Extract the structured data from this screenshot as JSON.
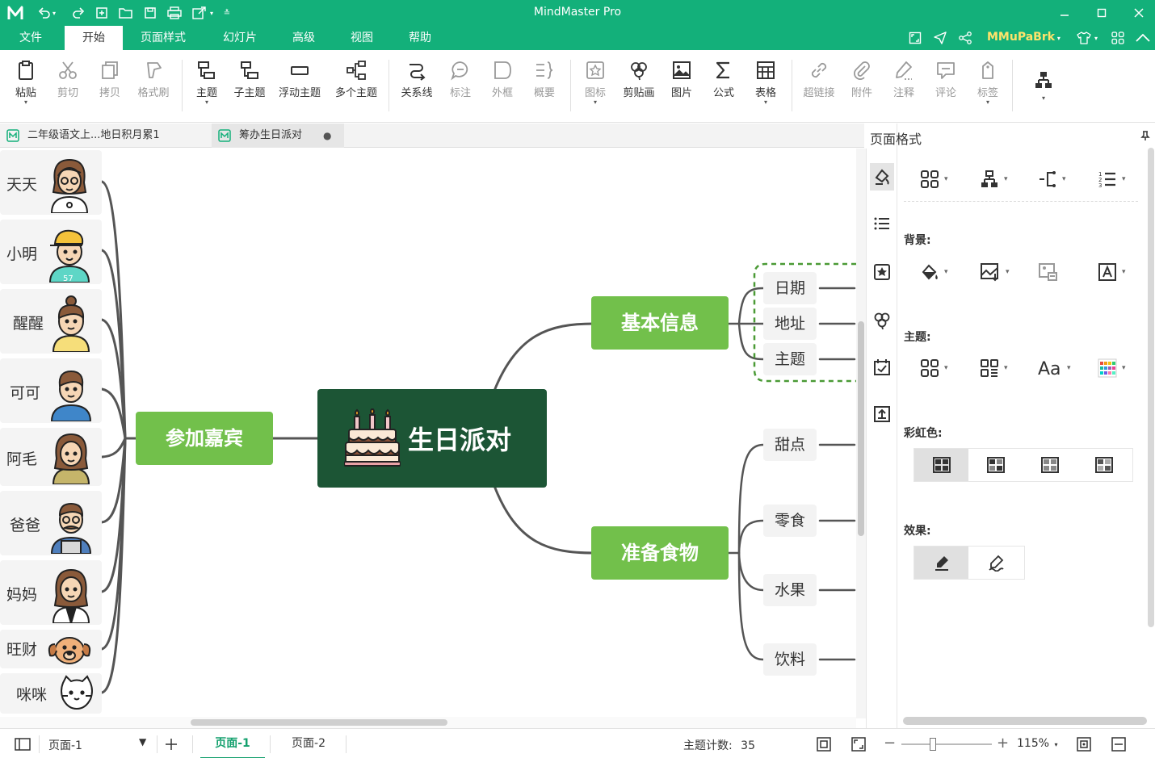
{
  "app": {
    "title": "MindMaster Pro",
    "user": "MMuPaBrk"
  },
  "menu": [
    {
      "label": "文件"
    },
    {
      "label": "开始"
    },
    {
      "label": "页面样式"
    },
    {
      "label": "幻灯片"
    },
    {
      "label": "高级"
    },
    {
      "label": "视图"
    },
    {
      "label": "帮助"
    }
  ],
  "active_menu": "开始",
  "ribbon": {
    "paste": "粘贴",
    "cut": "剪切",
    "copy": "拷贝",
    "format_painter": "格式刷",
    "topic": "主题",
    "subtopic": "子主题",
    "floating_topic": "浮动主题",
    "multiple_topics": "多个主题",
    "relationship": "关系线",
    "callout": "标注",
    "boundary": "外框",
    "summary": "概要",
    "icon": "图标",
    "clipart": "剪贴画",
    "picture": "图片",
    "formula": "公式",
    "table": "表格",
    "hyperlink": "超链接",
    "attachment": "附件",
    "note": "注释",
    "comment": "评论",
    "tag": "标签"
  },
  "tabs": [
    {
      "label": "二年级语文上...地日积月累1"
    },
    {
      "label": "筹办生日派对"
    }
  ],
  "mindmap": {
    "center": "生日派对",
    "branch_left": "参加嘉宾",
    "branch_right_top": "基本信息",
    "branch_right_bottom": "准备食物",
    "info_items": [
      "日期",
      "地址",
      "主题"
    ],
    "food_items": [
      "甜点",
      "零食",
      "水果",
      "饮料"
    ],
    "guests": [
      "天天",
      "小明",
      "醒醒",
      "可可",
      "阿毛",
      "爸爸",
      "妈妈",
      "旺财",
      "咪咪"
    ]
  },
  "panel": {
    "title": "页面格式",
    "background_label": "背景:",
    "topic_label": "主题:",
    "rainbow_label": "彩虹色:",
    "effect_label": "效果:"
  },
  "status": {
    "page_select": "页面-1",
    "pages": [
      "页面-1",
      "页面-2"
    ],
    "topic_count_label": "主题计数:",
    "topic_count": "35",
    "zoom": "115%",
    "zoom_level": 0.35
  },
  "colors": {
    "brand": "#13b07a",
    "center_node": "#1c5535",
    "main_node": "#72c04b",
    "user_name": "#ffe36b"
  }
}
